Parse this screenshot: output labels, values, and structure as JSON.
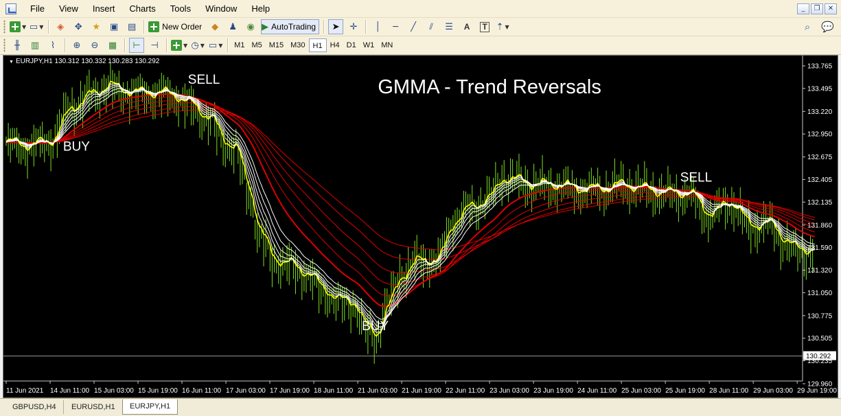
{
  "menu": [
    "File",
    "View",
    "Insert",
    "Charts",
    "Tools",
    "Window",
    "Help"
  ],
  "window_controls": [
    "_",
    "❐",
    "✕"
  ],
  "toolbar": {
    "new_order": "New Order",
    "auto_trading": "AutoTrading",
    "text_tool": "A",
    "label_tool": "T",
    "timeframes": [
      "M1",
      "M5",
      "M15",
      "M30",
      "H1",
      "H4",
      "D1",
      "W1",
      "MN"
    ],
    "active_timeframe": "H1"
  },
  "chart": {
    "symbol_line": "EURJPY,H1  130.312 130.332 130.283 130.292",
    "title_annotation": "GMMA - Trend Reversals",
    "current_price_label": "130.292",
    "background": "#000000",
    "price_axis": [
      "133.765",
      "133.495",
      "133.220",
      "132.950",
      "132.675",
      "132.405",
      "132.135",
      "131.860",
      "131.590",
      "131.320",
      "131.050",
      "130.775",
      "130.505",
      "130.235",
      "129.960"
    ],
    "time_axis": [
      "11 Jun 2021",
      "14 Jun 11:00",
      "15 Jun 03:00",
      "15 Jun 19:00",
      "16 Jun 11:00",
      "17 Jun 03:00",
      "17 Jun 19:00",
      "18 Jun 11:00",
      "21 Jun 03:00",
      "21 Jun 19:00",
      "22 Jun 11:00",
      "23 Jun 03:00",
      "23 Jun 19:00",
      "24 Jun 11:00",
      "25 Jun 03:00",
      "25 Jun 19:00",
      "28 Jun 11:00",
      "29 Jun 03:00",
      "29 Jun 19:00"
    ],
    "annotations": [
      {
        "text": "BUY",
        "price": 132.75,
        "time": 1.6
      },
      {
        "text": "SELL",
        "price": 133.55,
        "time": 4.5
      },
      {
        "text": "BUY",
        "price": 130.6,
        "time": 8.4
      },
      {
        "text": "SELL",
        "price": 132.38,
        "time": 15.7
      }
    ],
    "colors": {
      "short_ema": "#ffffff",
      "long_ema": "#e00000",
      "price": "#7fe020",
      "price_highlight": "#ffff00",
      "axis_text": "#ffffff"
    }
  },
  "chart_data": {
    "type": "line",
    "title": "GMMA - Trend Reversals",
    "xlabel": "",
    "ylabel": "",
    "ylim": [
      129.96,
      133.85
    ],
    "x_ticks": [
      "11 Jun 2021",
      "14 Jun 11:00",
      "15 Jun 03:00",
      "15 Jun 19:00",
      "16 Jun 11:00",
      "17 Jun 03:00",
      "17 Jun 19:00",
      "18 Jun 11:00",
      "21 Jun 03:00",
      "21 Jun 19:00",
      "22 Jun 11:00",
      "23 Jun 03:00",
      "23 Jun 19:00",
      "24 Jun 11:00",
      "25 Jun 03:00",
      "25 Jun 19:00",
      "28 Jun 11:00",
      "29 Jun 03:00",
      "29 Jun 19:00"
    ],
    "y_ticks": [
      133.765,
      133.495,
      133.22,
      132.95,
      132.675,
      132.405,
      132.135,
      131.86,
      131.59,
      131.32,
      131.05,
      130.775,
      130.505,
      130.235,
      129.96
    ],
    "grid": false,
    "series": [
      {
        "values": [
          [
            0,
            132.85
          ],
          [
            0.5,
            132.82
          ],
          [
            1,
            132.88
          ],
          [
            1.5,
            133.3
          ],
          [
            2,
            133.45
          ],
          [
            2.3,
            133.55
          ],
          [
            2.6,
            133.48
          ],
          [
            3,
            133.45
          ],
          [
            3.5,
            133.45
          ],
          [
            3.8,
            133.42
          ],
          [
            4.2,
            133.3
          ],
          [
            4.6,
            133.15
          ],
          [
            5,
            132.85
          ],
          [
            5.2,
            132.8
          ],
          [
            5.5,
            132.3
          ],
          [
            5.8,
            131.7
          ],
          [
            6.1,
            131.45
          ],
          [
            6.4,
            131.4
          ],
          [
            6.8,
            131.3
          ],
          [
            7.2,
            131.1
          ],
          [
            7.6,
            130.95
          ],
          [
            7.9,
            130.95
          ],
          [
            8.2,
            130.6
          ],
          [
            8.4,
            130.55
          ],
          [
            8.7,
            130.95
          ],
          [
            9,
            131.3
          ],
          [
            9.4,
            131.45
          ],
          [
            9.8,
            131.45
          ],
          [
            10.2,
            131.95
          ],
          [
            10.6,
            132.1
          ],
          [
            11,
            132.2
          ],
          [
            11.3,
            132.45
          ],
          [
            11.6,
            132.4
          ],
          [
            12,
            132.35
          ],
          [
            12.5,
            132.35
          ],
          [
            13,
            132.3
          ],
          [
            13.5,
            132.3
          ],
          [
            14,
            132.35
          ],
          [
            14.5,
            132.3
          ],
          [
            15,
            132.25
          ],
          [
            15.5,
            132.25
          ],
          [
            16,
            132.0
          ],
          [
            16.5,
            132.15
          ],
          [
            16.9,
            131.85
          ],
          [
            17.3,
            131.9
          ],
          [
            17.7,
            131.7
          ],
          [
            18,
            131.55
          ],
          [
            18.4,
            131.6
          ]
        ]
      },
      {
        "values": [
          [
            0,
            133.15
          ],
          [
            1,
            132.95
          ],
          [
            2,
            133.25
          ],
          [
            3,
            133.35
          ],
          [
            4,
            133.35
          ],
          [
            5,
            132.9
          ],
          [
            6,
            132.2
          ],
          [
            7,
            131.5
          ],
          [
            8,
            131.0
          ],
          [
            8.5,
            130.9
          ],
          [
            9,
            131.25
          ],
          [
            10,
            131.45
          ],
          [
            11,
            131.85
          ],
          [
            12,
            132.05
          ],
          [
            13,
            132.15
          ],
          [
            14,
            132.25
          ],
          [
            15,
            132.3
          ],
          [
            16,
            132.2
          ],
          [
            17,
            132.05
          ],
          [
            18,
            131.9
          ],
          [
            18.4,
            131.82
          ]
        ]
      }
    ]
  },
  "tabs": [
    "GBPUSD,H4",
    "EURUSD,H1",
    "EURJPY,H1"
  ],
  "active_tab": "EURJPY,H1"
}
